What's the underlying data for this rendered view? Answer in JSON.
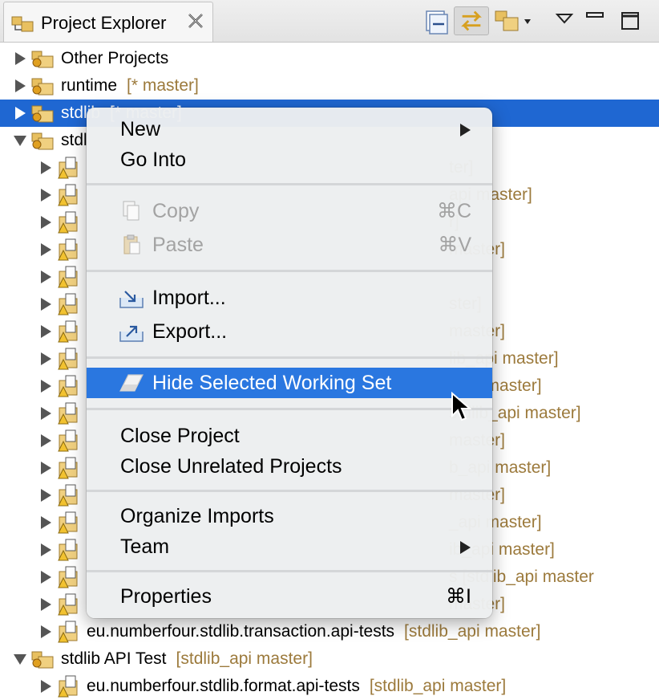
{
  "view": {
    "title": "Project Explorer",
    "toolbar_icons": [
      "collapse-all-icon",
      "link-with-editor-icon",
      "project-menu-icon",
      "view-menu-icon",
      "minimize-icon",
      "maximize-icon"
    ]
  },
  "tree": {
    "rows": [
      {
        "label": "Other Projects",
        "decoration": ""
      },
      {
        "label": "runtime",
        "decoration": "[* master]"
      },
      {
        "label": "stdlib",
        "decoration": "[* master]"
      },
      {
        "label": "stdl",
        "decoration": ""
      },
      {
        "label": "",
        "decoration": "ter]"
      },
      {
        "label": "",
        "decoration": "api master]"
      },
      {
        "label": "",
        "decoration": "r]"
      },
      {
        "label": "",
        "decoration": "master]"
      },
      {
        "label": "",
        "decoration": ""
      },
      {
        "label": "",
        "decoration": "ster]"
      },
      {
        "label": "",
        "decoration": "master]"
      },
      {
        "label": "",
        "decoration": "lib_api master]"
      },
      {
        "label": "",
        "decoration": "_api master]"
      },
      {
        "label": "",
        "decoration": "stdlib_api master]"
      },
      {
        "label": "",
        "decoration": "master]"
      },
      {
        "label": "",
        "decoration": "b_api master]"
      },
      {
        "label": "",
        "decoration": "master]"
      },
      {
        "label": "",
        "decoration": "_api master]"
      },
      {
        "label": "",
        "decoration": "ib_api master]"
      },
      {
        "label": "",
        "decoration": "s  [stdlib_api master"
      },
      {
        "label": "",
        "decoration": "master]"
      },
      {
        "label": "eu.numberfour.stdlib.transaction.api-tests",
        "decoration": "[stdlib_api master]"
      },
      {
        "label": "stdlib API Test",
        "decoration": "[stdlib_api master]"
      },
      {
        "label": "eu.numberfour.stdlib.format.api-tests",
        "decoration": "[stdlib_api master]"
      }
    ]
  },
  "context_menu": {
    "new": "New",
    "go_into": "Go Into",
    "copy": "Copy",
    "copy_shortcut": "⌘C",
    "paste": "Paste",
    "paste_shortcut": "⌘V",
    "import": "Import...",
    "export": "Export...",
    "hide_working_set": "Hide Selected Working Set",
    "close_project": "Close Project",
    "close_unrelated": "Close Unrelated Projects",
    "organize_imports": "Organize Imports",
    "team": "Team",
    "properties": "Properties",
    "properties_shortcut": "⌘I"
  },
  "colors": {
    "selection": "#1f67d2",
    "menu_highlight": "#2a77e0",
    "git_decoration": "#9c7a3c"
  }
}
